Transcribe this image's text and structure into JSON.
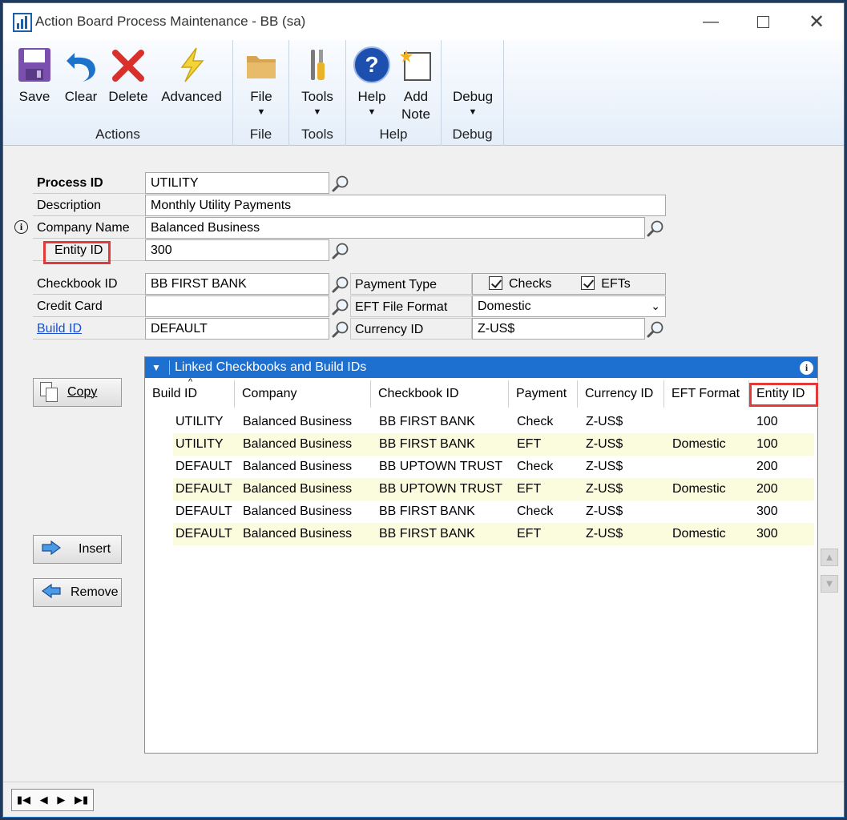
{
  "window": {
    "title": "Action Board Process Maintenance  -  BB (sa)"
  },
  "ribbon": {
    "groups": [
      {
        "label": "Actions",
        "buttons": [
          "Save",
          "Clear",
          "Delete",
          "Advanced"
        ]
      },
      {
        "label": "File",
        "buttons": [
          "File"
        ]
      },
      {
        "label": "Tools",
        "buttons": [
          "Tools"
        ]
      },
      {
        "label": "Help",
        "buttons": [
          "Help",
          "Add",
          "Note"
        ]
      },
      {
        "label": "Debug",
        "buttons": [
          "Debug"
        ]
      }
    ]
  },
  "form": {
    "process_id": {
      "label": "Process ID",
      "value": "UTILITY"
    },
    "description": {
      "label": "Description",
      "value": "Monthly Utility Payments"
    },
    "company_name": {
      "label": "Company Name",
      "value": "Balanced Business"
    },
    "entity_id": {
      "label": "Entity ID",
      "value": "300"
    },
    "checkbook_id": {
      "label": "Checkbook ID",
      "value": "BB FIRST BANK"
    },
    "credit_card": {
      "label": "Credit Card",
      "value": ""
    },
    "build_id": {
      "label": "Build ID",
      "value": "DEFAULT"
    },
    "payment_type": {
      "label": "Payment Type",
      "checks_label": "Checks",
      "efts_label": "EFTs",
      "checks": true,
      "efts": true
    },
    "eft_file_format": {
      "label": "EFT File Format",
      "value": "Domestic"
    },
    "currency_id": {
      "label": "Currency ID",
      "value": "Z-US$"
    }
  },
  "buttons": {
    "copy": "Copy",
    "insert": "Insert",
    "remove": "Remove"
  },
  "grid": {
    "title": "Linked Checkbooks and Build IDs",
    "columns": [
      "Build ID",
      "Company",
      "Checkbook  ID",
      "Payment",
      "Currency ID",
      "EFT Format",
      "Entity ID"
    ],
    "rows": [
      [
        "UTILITY",
        "Balanced Business",
        "BB FIRST BANK",
        "Check",
        "Z-US$",
        "",
        "100"
      ],
      [
        "UTILITY",
        "Balanced Business",
        "BB FIRST BANK",
        "EFT",
        "Z-US$",
        "Domestic",
        "100"
      ],
      [
        "DEFAULT",
        "Balanced Business",
        "BB UPTOWN TRUST",
        "Check",
        "Z-US$",
        "",
        "200"
      ],
      [
        "DEFAULT",
        "Balanced Business",
        "BB UPTOWN TRUST",
        "EFT",
        "Z-US$",
        "Domestic",
        "200"
      ],
      [
        "DEFAULT",
        "Balanced Business",
        "BB FIRST BANK",
        "Check",
        "Z-US$",
        "",
        "300"
      ],
      [
        "DEFAULT",
        "Balanced Business",
        "BB FIRST BANK",
        "EFT",
        "Z-US$",
        "Domestic",
        "300"
      ]
    ]
  },
  "colors": {
    "accent": "#1d6fd0",
    "highlight": "#e03a3a",
    "alt_row": "#fbfbde",
    "link": "#1a4fd0"
  },
  "icons": [
    "save-icon",
    "undo-icon",
    "delete-x-icon",
    "lightning-icon",
    "folder-icon",
    "tools-icon",
    "help-icon",
    "note-icon",
    "lookup-icon",
    "info-icon",
    "copy-icon",
    "arrow-right-icon",
    "arrow-left-icon"
  ]
}
